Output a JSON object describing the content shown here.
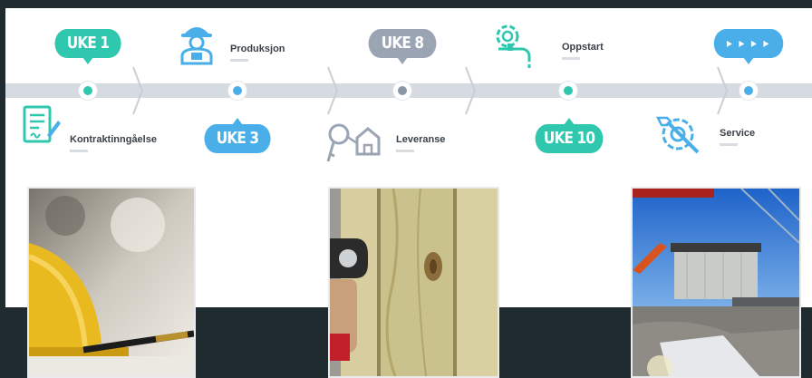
{
  "colors": {
    "teal": "#2fc7ae",
    "blue": "#4aaee9",
    "grey": "#9aa4b3",
    "track": "#d6dbe1"
  },
  "timeline": {
    "bubbles": [
      {
        "text": "UKE 1"
      },
      {
        "text": "UKE 3"
      },
      {
        "text": "UKE 8"
      },
      {
        "text": "UKE 10"
      },
      {
        "text": "▸ ▸ ▸ ▸"
      }
    ],
    "steps": [
      {
        "label": "Kontraktinngåelse",
        "icon": "contract-icon"
      },
      {
        "label": "Produksjon",
        "icon": "worker-icon"
      },
      {
        "label": "Leveranse",
        "icon": "keys-icon"
      },
      {
        "label": "Oppstart",
        "icon": "gear-faucet-icon"
      },
      {
        "label": "Service",
        "icon": "wrench-gear-icon"
      }
    ]
  },
  "photos": [
    {
      "subject": "hard-hat-photo"
    },
    {
      "subject": "wood-drill-photo"
    },
    {
      "subject": "module-lift-photo"
    }
  ]
}
